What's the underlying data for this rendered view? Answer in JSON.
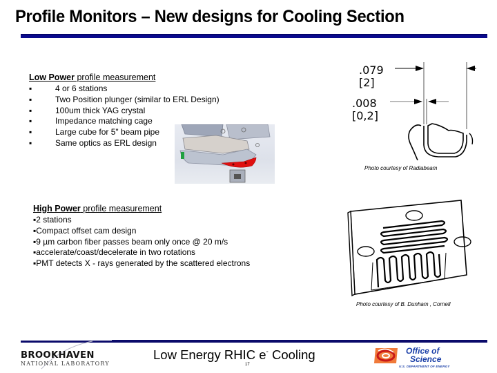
{
  "slide": {
    "title": "Profile Monitors – New designs for Cooling Section",
    "low_power": {
      "heading_bold": "Low Power",
      "heading_rest": " profile measurement",
      "bullet_glyph": "▪",
      "items": [
        "4 or 6 stations",
        "Two Position plunger (similar to ERL Design)",
        "100um thick YAG crystal",
        "Impedance matching cage",
        "Large cube for 5\" beam pipe",
        "Same optics as ERL design"
      ]
    },
    "drawing1": {
      "dim1_inch": ".079",
      "dim1_mm": "[2]",
      "dim2_inch": ".008",
      "dim2_mm": "[0,2]",
      "caption": "Photo courtesy of Radiabeam"
    },
    "high_power": {
      "heading_bold": "High Power",
      "heading_rest": " profile measurement",
      "bullet_glyph": "▪",
      "items": [
        "2 stations",
        "Compact offset cam design",
        "9 µm carbon fiber passes beam only once @ 20 m/s",
        "accelerate/coast/decelerate in two rotations",
        "PMT detects X - rays generated by the scattered electrons"
      ]
    },
    "drawing2": {
      "caption": "Photo courtesy of B. Dunham , Cornell"
    },
    "footer": {
      "title_main": "Low Energy RHIC e",
      "title_sup": "-",
      "title_end": " Cooling",
      "page_number": "17",
      "bnl_name": "BROOKHAVEN",
      "bnl_sub": "NATIONAL LABORATORY",
      "doe_line1": "Office of",
      "doe_line2": "Science",
      "doe_line3": "U.S. DEPARTMENT OF ENERGY"
    },
    "colors": {
      "title_bar": "#0a0a8c",
      "doe_blue": "#1a3fa8",
      "doe_orange": "#e8541c",
      "cad_red": "#e01010",
      "cad_green": "#1fa040"
    }
  }
}
